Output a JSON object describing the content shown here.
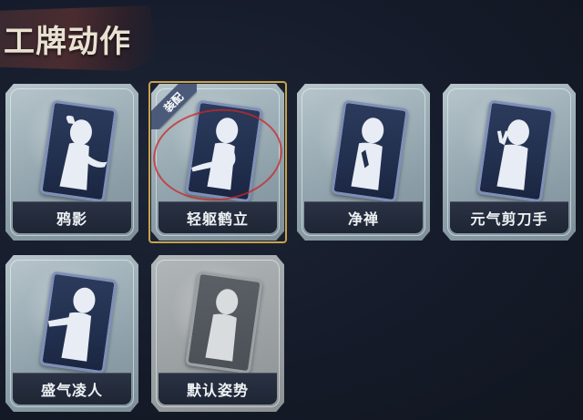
{
  "title": "工牌动作",
  "equipped_badge": "装配",
  "cards": [
    {
      "label": "鸦影",
      "pose": "silhouette-pose-crow-shadow-icon",
      "selected": false,
      "locked": false
    },
    {
      "label": "轻躯鹤立",
      "pose": "silhouette-pose-crane-stance-icon",
      "selected": true,
      "locked": false
    },
    {
      "label": "净禅",
      "pose": "silhouette-pose-zen-icon",
      "selected": false,
      "locked": false
    },
    {
      "label": "元气剪刀手",
      "pose": "silhouette-pose-peace-sign-icon",
      "selected": false,
      "locked": false
    },
    {
      "label": "盛气凌人",
      "pose": "silhouette-pose-arrogant-icon",
      "selected": false,
      "locked": false
    },
    {
      "label": "默认姿势",
      "pose": "silhouette-pose-default-icon",
      "selected": false,
      "locked": true
    }
  ],
  "colors": {
    "background": "#151b2a",
    "frame": "#9fb0b8",
    "inner_card": "#22304f",
    "selected_outline": "#c9a24a",
    "badge": "#4c5a7a",
    "annotation_circle": "#c82828"
  }
}
